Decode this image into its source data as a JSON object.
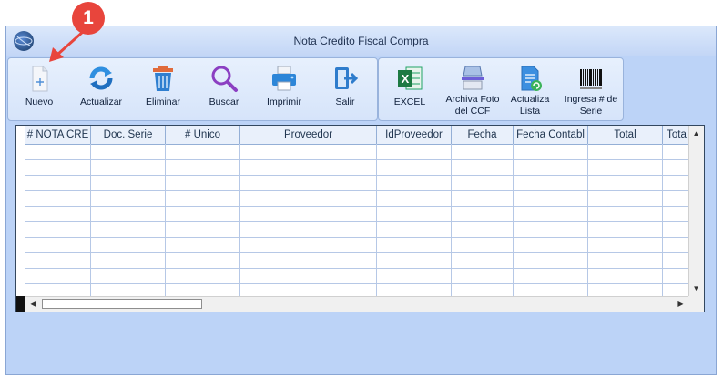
{
  "window": {
    "title": "Nota Credito Fiscal Compra"
  },
  "toolbar": {
    "nuevo": "Nuevo",
    "actualizar": "Actualizar",
    "eliminar": "Eliminar",
    "buscar": "Buscar",
    "imprimir": "Imprimir",
    "salir": "Salir",
    "excel": "EXCEL",
    "archiva_foto_line1": "Archiva Foto",
    "archiva_foto_line2": "del CCF",
    "actualiza_lista_line1": "Actualiza",
    "actualiza_lista_line2": "Lista",
    "ingresa_serie_line1": "Ingresa # de",
    "ingresa_serie_line2": "Serie",
    "excel_glyph": "X"
  },
  "grid": {
    "columns": [
      "# NOTA CRE",
      "Doc. Serie",
      "# Unico",
      "Proveedor",
      "IdProveedor",
      "Fecha",
      "Fecha Contabl",
      "Total",
      "Tota"
    ],
    "rows": []
  },
  "annotation": {
    "step": "1",
    "color": "#e8453c"
  },
  "icons": {
    "app": "globe-icon",
    "nuevo": "new-document-icon",
    "actualizar": "refresh-icon",
    "eliminar": "trash-icon",
    "buscar": "magnifier-icon",
    "imprimir": "printer-icon",
    "salir": "exit-door-icon",
    "excel": "excel-icon",
    "archiva": "scanner-icon",
    "actualiza_lista": "refresh-list-icon",
    "serie": "barcode-icon"
  }
}
